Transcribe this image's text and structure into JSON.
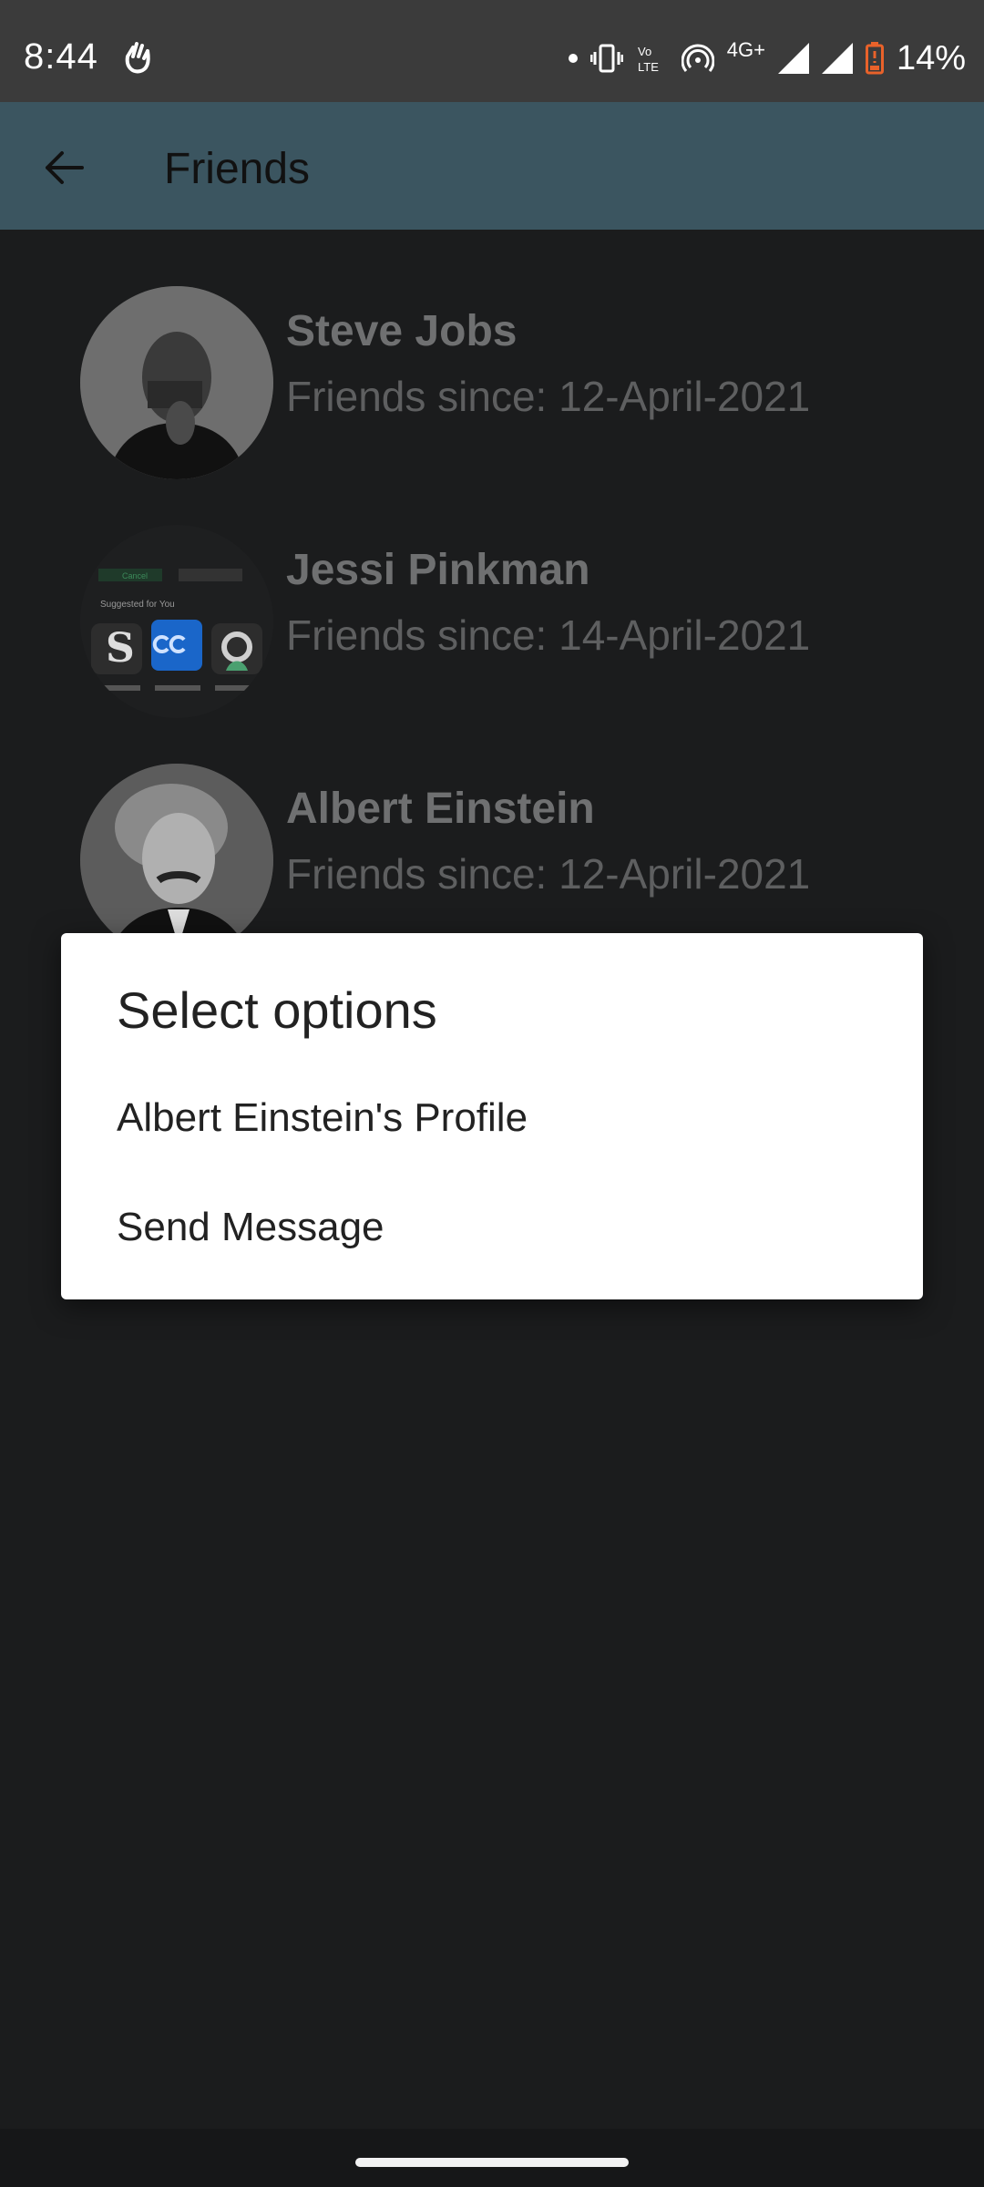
{
  "status": {
    "time": "8:44",
    "battery": "14%",
    "network": "4G+",
    "icons": [
      "gesture-icon",
      "dot-icon",
      "vibrate-icon",
      "volte-icon",
      "hotspot-icon",
      "signal-icon",
      "signal-icon",
      "battery-icon"
    ],
    "battery_color": "#e9622a"
  },
  "app_bar": {
    "title": "Friends",
    "color": "#3b5560"
  },
  "friends": [
    {
      "name": "Steve Jobs",
      "since": "Friends since: 12-April-2021"
    },
    {
      "name": "Jessi Pinkman",
      "since": "Friends since: 14-April-2021"
    },
    {
      "name": "Albert Einstein",
      "since": "Friends since: 12-April-2021"
    }
  ],
  "dialog": {
    "title": "Select options",
    "options": [
      {
        "label": "Albert Einstein's Profile"
      },
      {
        "label": "Send Message"
      }
    ]
  },
  "avatar_app_preview": {
    "header": "Suggested for You",
    "button": "Cancel"
  }
}
